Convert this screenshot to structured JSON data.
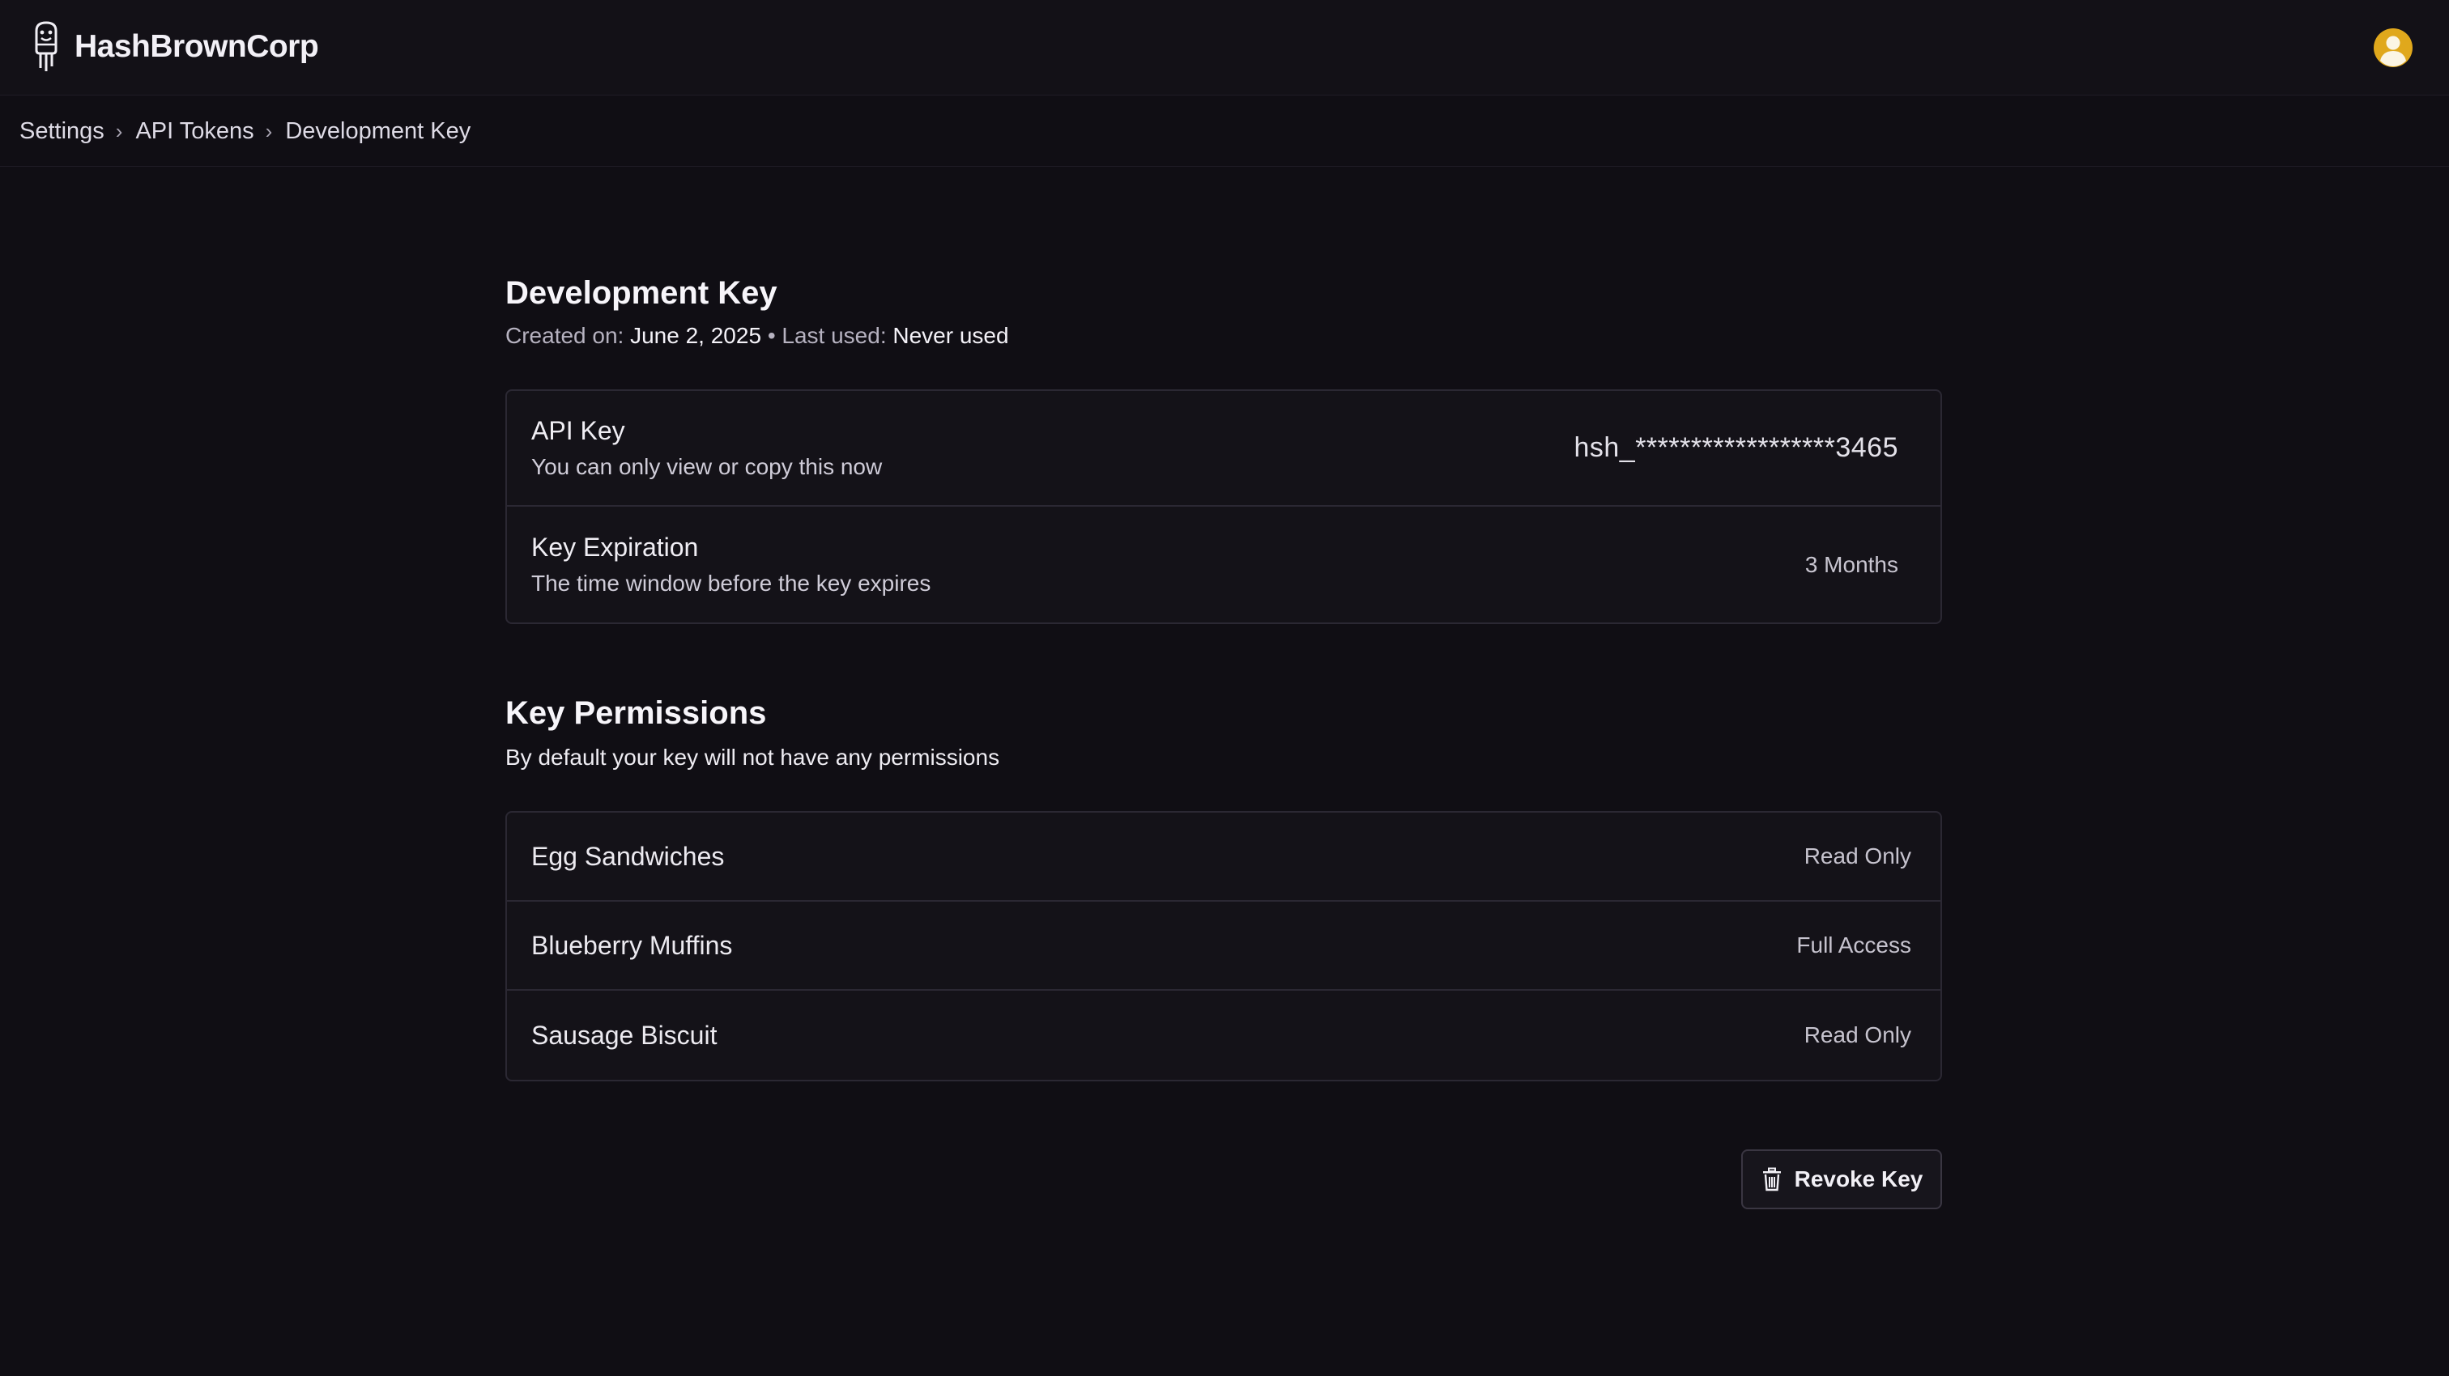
{
  "app": {
    "name": "HashBrownCorp"
  },
  "breadcrumb": [
    "Settings",
    "API Tokens",
    "Development Key"
  ],
  "key": {
    "title": "Development Key",
    "created_label": "Created on:",
    "created_value": "June 2, 2025",
    "separator": "•",
    "last_used_label": "Last used:",
    "last_used_value": "Never used",
    "api_key": {
      "title": "API Key",
      "subtitle": "You can only view or copy this now",
      "value": "hsh_******************3465"
    },
    "expiration": {
      "title": "Key Expiration",
      "subtitle": "The time window before the key expires",
      "value": "3 Months"
    }
  },
  "permissions": {
    "title": "Key Permissions",
    "description": "By default your key will not have any permissions",
    "items": [
      {
        "name": "Egg Sandwiches",
        "level": "Read Only"
      },
      {
        "name": "Blueberry Muffins",
        "level": "Full Access"
      },
      {
        "name": "Sausage Biscuit",
        "level": "Read Only"
      }
    ]
  },
  "actions": {
    "revoke_label": "Revoke Key"
  },
  "icons": {
    "logo": "hashbrown-logo-icon",
    "avatar": "user-avatar-icon",
    "chevron": "chevron-right-icon",
    "trash": "trash-icon"
  },
  "colors": {
    "background": "#100e14",
    "avatar": "#e0a81c"
  }
}
